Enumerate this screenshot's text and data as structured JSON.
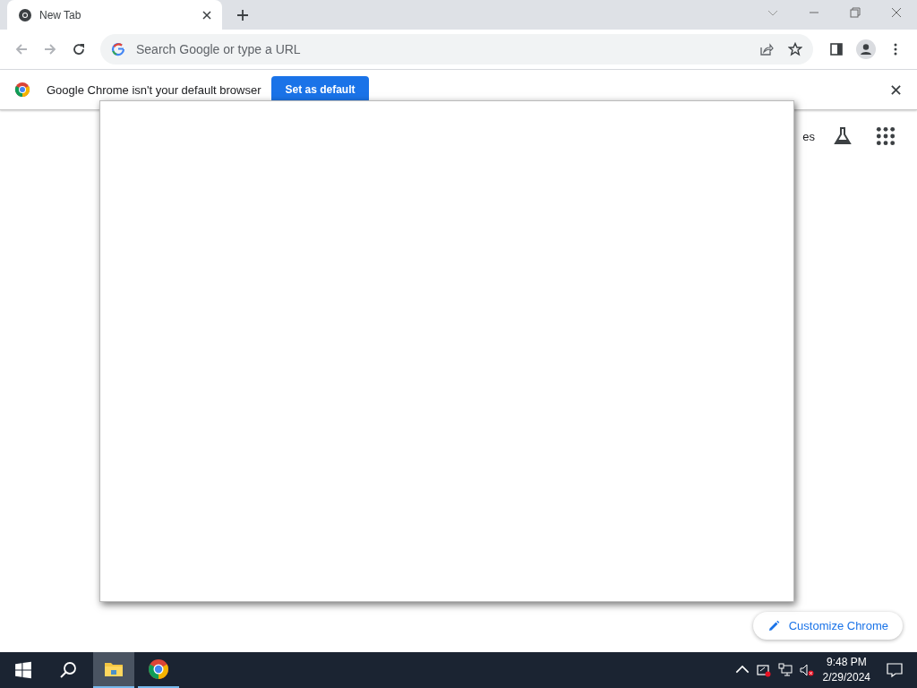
{
  "tabs": [
    {
      "title": "New Tab",
      "selected": true
    }
  ],
  "omnibox": {
    "placeholder": "Search Google or type a URL"
  },
  "infobar": {
    "message": "Google Chrome isn't your default browser",
    "button": "Set as default"
  },
  "ntp": {
    "partial_link": "es",
    "customize": "Customize Chrome"
  },
  "taskbar": {
    "apps": [
      {
        "kind": "explorer",
        "active": true
      },
      {
        "kind": "chrome",
        "active": false
      }
    ],
    "time": "9:48 PM",
    "date": "2/29/2024"
  }
}
